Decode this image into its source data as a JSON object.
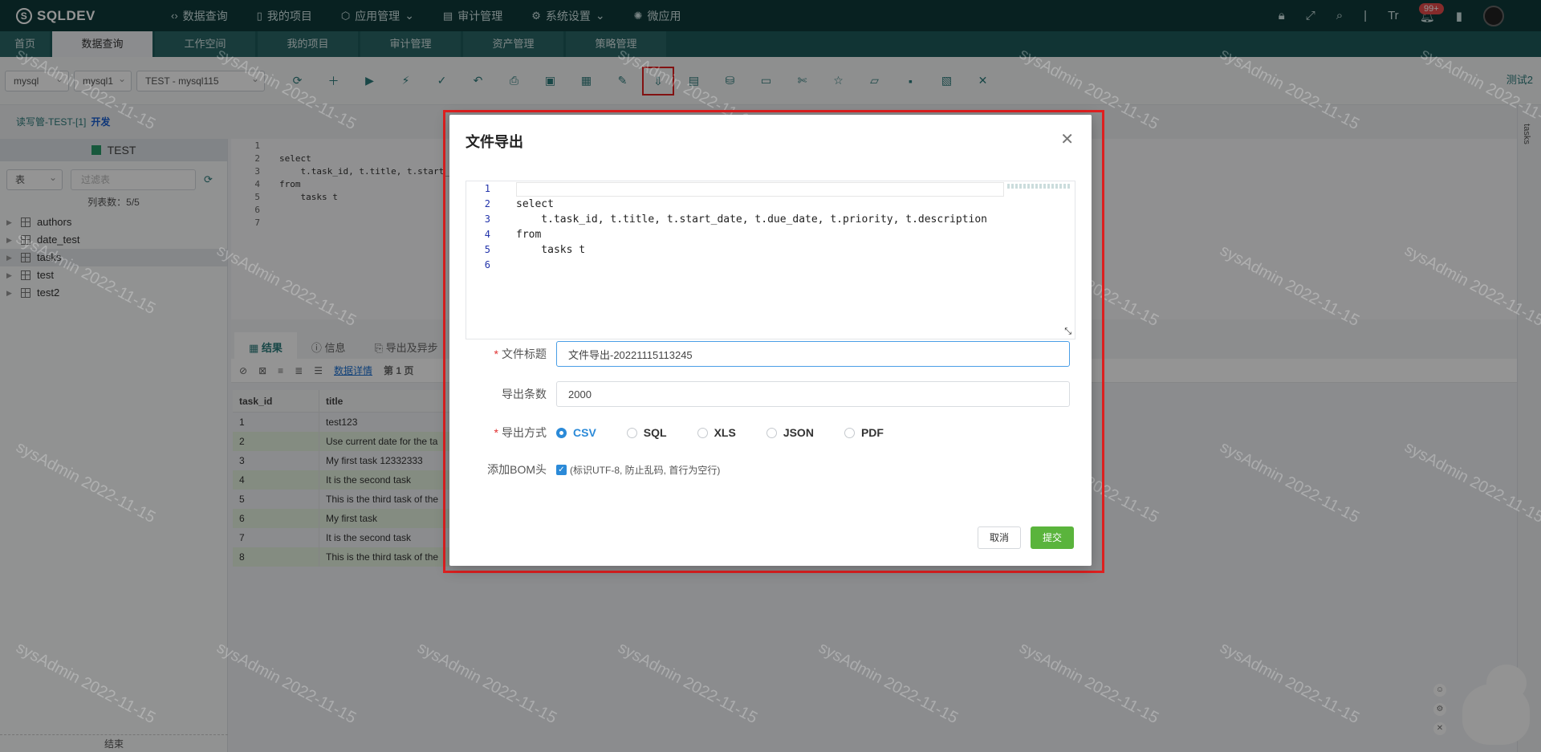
{
  "app": {
    "brand": "SQLDEV",
    "nav": [
      {
        "icon": "code-icon",
        "label": "数据查询"
      },
      {
        "icon": "file-icon",
        "label": "我的项目"
      },
      {
        "icon": "apps-icon",
        "label": "应用管理"
      },
      {
        "icon": "audit-icon",
        "label": "审计管理"
      },
      {
        "icon": "gear-icon",
        "label": "系统设置"
      },
      {
        "icon": "microapp-icon",
        "label": "微应用"
      }
    ],
    "notification_count": "99+"
  },
  "tabs": [
    "首页",
    "数据查询",
    "工作空间",
    "我的项目",
    "审计管理",
    "资产管理",
    "策略管理"
  ],
  "toolbar": {
    "db_type": "mysql",
    "db_instance": "mysql1",
    "connection": "TEST - mysql115",
    "right_label": "测试2"
  },
  "breadcrumb": {
    "path": "读写管-TEST-[1]",
    "env": "开发"
  },
  "left_panel": {
    "schema": "TEST",
    "object_type": "表",
    "filter_placeholder": "过滤表",
    "count_text": "列表数：5/5",
    "tables": [
      "authors",
      "date_test",
      "tasks",
      "test",
      "test2"
    ],
    "footer": "结束"
  },
  "editor": {
    "lines": [
      "",
      "select",
      "    t.task_id, t.title, t.start_",
      "from",
      "    tasks t",
      "",
      ""
    ]
  },
  "results": {
    "tabs": [
      "结果",
      "信息",
      "导出及异步"
    ],
    "detail_link": "数据详情",
    "page": "第 1 页",
    "columns": [
      "task_id",
      "title"
    ],
    "rows": [
      {
        "id": "1",
        "title": "test123"
      },
      {
        "id": "2",
        "title": "Use current date for the ta"
      },
      {
        "id": "3",
        "title": "My first task 12332333"
      },
      {
        "id": "4",
        "title": "It is the second task"
      },
      {
        "id": "5",
        "title": "This is the third task of the"
      },
      {
        "id": "6",
        "title": "My first task"
      },
      {
        "id": "7",
        "title": "It is the second task"
      },
      {
        "id": "8",
        "title": "This is the third task of the"
      }
    ]
  },
  "dialog": {
    "title": "文件导出",
    "sql_lines": [
      {
        "n": "1",
        "text": ""
      },
      {
        "n": "2",
        "text": "select"
      },
      {
        "n": "3",
        "text": "    t.task_id, t.title, t.start_date, t.due_date, t.priority, t.description"
      },
      {
        "n": "4",
        "text": "from"
      },
      {
        "n": "5",
        "text": "    tasks t"
      },
      {
        "n": "6",
        "text": ""
      }
    ],
    "file_title_label": "文件标题",
    "file_title_value": "文件导出-20221115113245",
    "count_label": "导出条数",
    "count_value": "2000",
    "format_label": "导出方式",
    "formats": [
      "CSV",
      "SQL",
      "XLS",
      "JSON",
      "PDF"
    ],
    "selected_format": "CSV",
    "bom_label": "添加BOM头",
    "bom_hint": "(标识UTF-8, 防止乱码, 首行为空行)",
    "bom_checked": true,
    "cancel": "取消",
    "submit": "提交"
  },
  "watermark": "sysAdmin 2022-11-15",
  "side_label": "tasks"
}
